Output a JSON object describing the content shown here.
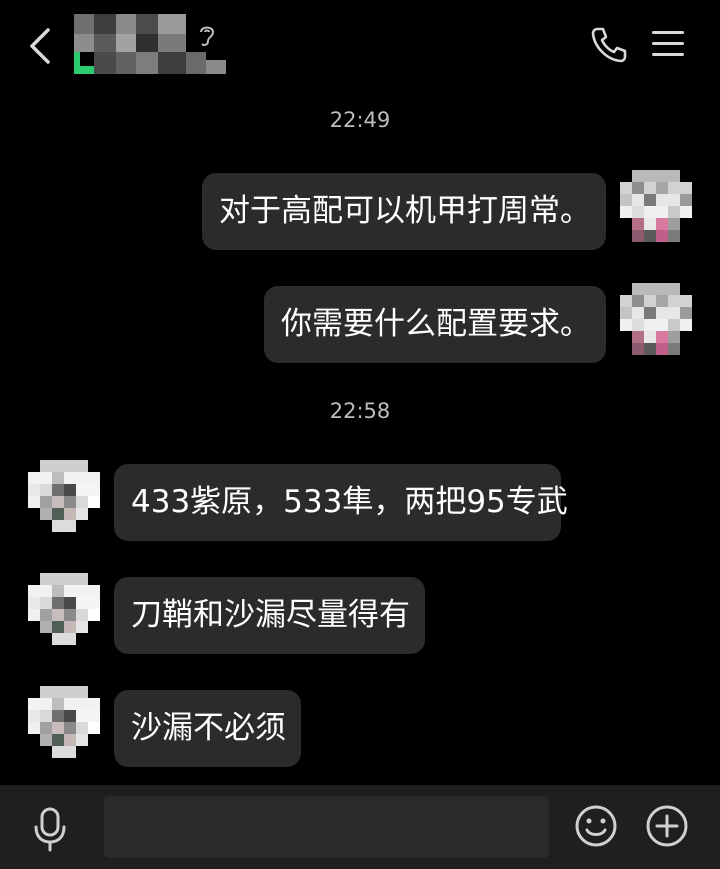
{
  "header": {
    "back_icon": "chevron-left-icon",
    "contact_name": "",
    "earpiece_icon": "earpiece-mode-icon",
    "call_icon": "phone-icon",
    "menu_icon": "menu-icon"
  },
  "messages": [
    {
      "type": "time",
      "text": "22:49"
    },
    {
      "type": "outgoing",
      "text": "对于高配可以机甲打周常。"
    },
    {
      "type": "outgoing",
      "text": "你需要什么配置要求。"
    },
    {
      "type": "time",
      "text": "22:58"
    },
    {
      "type": "incoming",
      "text": "433紫原，533隼，两把95专武"
    },
    {
      "type": "incoming",
      "text": "刀鞘和沙漏尽量得有"
    },
    {
      "type": "incoming",
      "text": "沙漏不必须"
    }
  ],
  "input_bar": {
    "voice_icon": "microphone-icon",
    "text_value": "",
    "emoji_icon": "emoji-icon",
    "more_icon": "plus-circle-icon"
  },
  "colors": {
    "background": "#000000",
    "bubble": "#2b2b2b",
    "bottom_bar": "#1e1f1e",
    "online_indicator": "#2ecc71"
  }
}
